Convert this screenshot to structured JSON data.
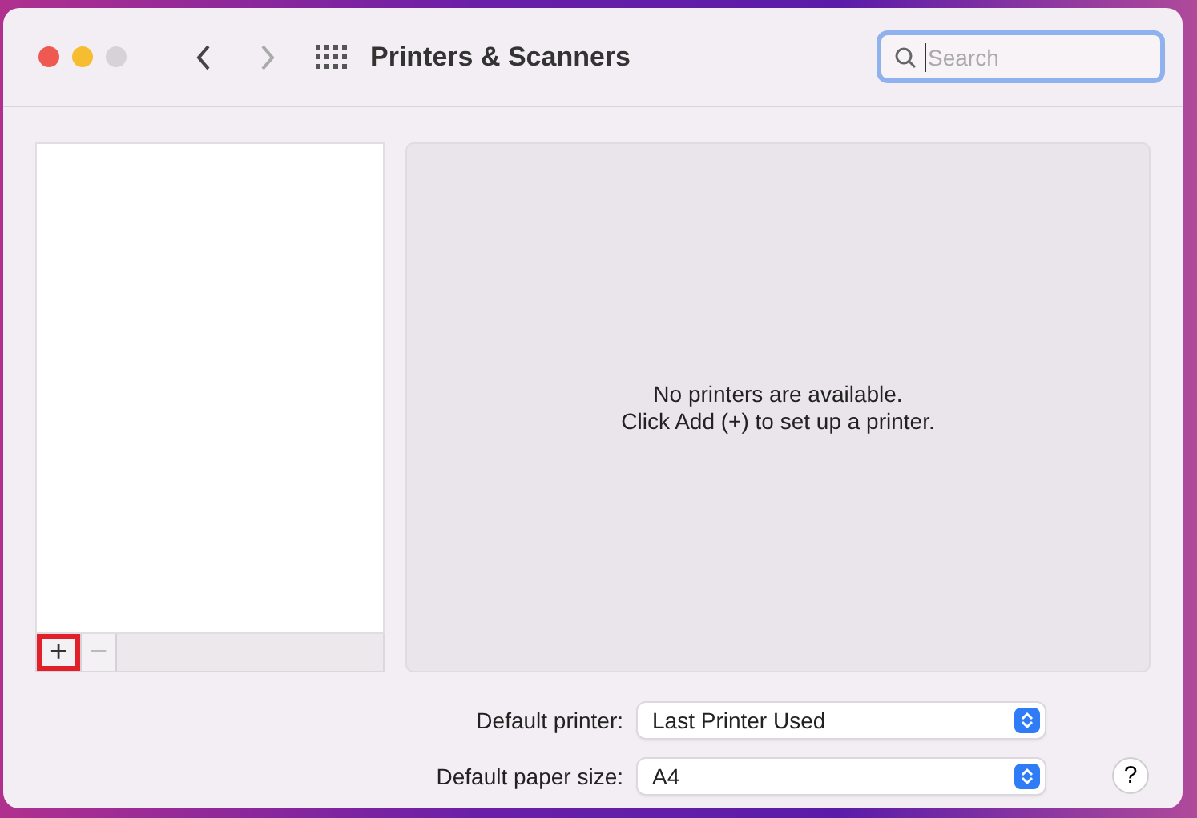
{
  "window": {
    "title": "Printers & Scanners"
  },
  "search": {
    "placeholder": "Search",
    "focused": true
  },
  "printer_list": {
    "add_button": "+",
    "remove_button": "−",
    "add_highlighted": true,
    "remove_disabled": true
  },
  "empty_message": [
    "No printers are available.",
    "Click Add (+) to set up a printer."
  ],
  "settings": [
    {
      "label": "Default printer:",
      "value": "Last Printer Used"
    },
    {
      "label": "Default paper size:",
      "value": "A4"
    }
  ],
  "help_button": "?"
}
